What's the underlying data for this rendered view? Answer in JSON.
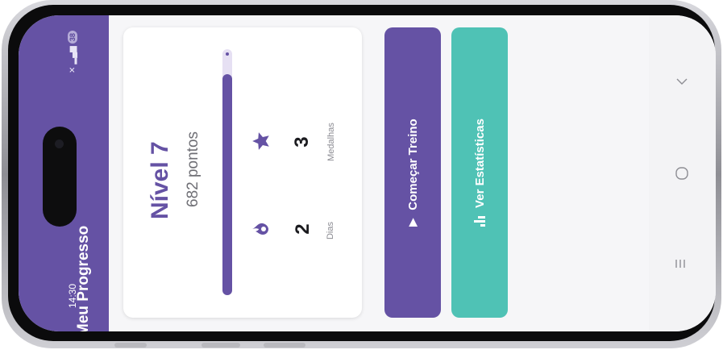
{
  "status_bar": {
    "time": "14:30",
    "battery": "38",
    "icons": [
      "mute-icon",
      "signal-icon",
      "battery-icon"
    ]
  },
  "app_bar": {
    "title": "Meu Progresso"
  },
  "progress_card": {
    "level": "Nível 7",
    "points": "682 pontos",
    "progress_fraction": 0.9,
    "stats": [
      {
        "icon": "flame-icon",
        "value": "2",
        "label": "Dias"
      },
      {
        "icon": "star-icon",
        "value": "3",
        "label": "Medalhas"
      }
    ]
  },
  "actions": {
    "start_label": "Começar Treino",
    "stats_label": "Ver Estatísticas"
  },
  "nav": [
    "recents-icon",
    "home-icon",
    "back-icon"
  ],
  "colors": {
    "primary": "#6552a4",
    "accent": "#4fc2b5",
    "background": "#f6f6f8"
  }
}
